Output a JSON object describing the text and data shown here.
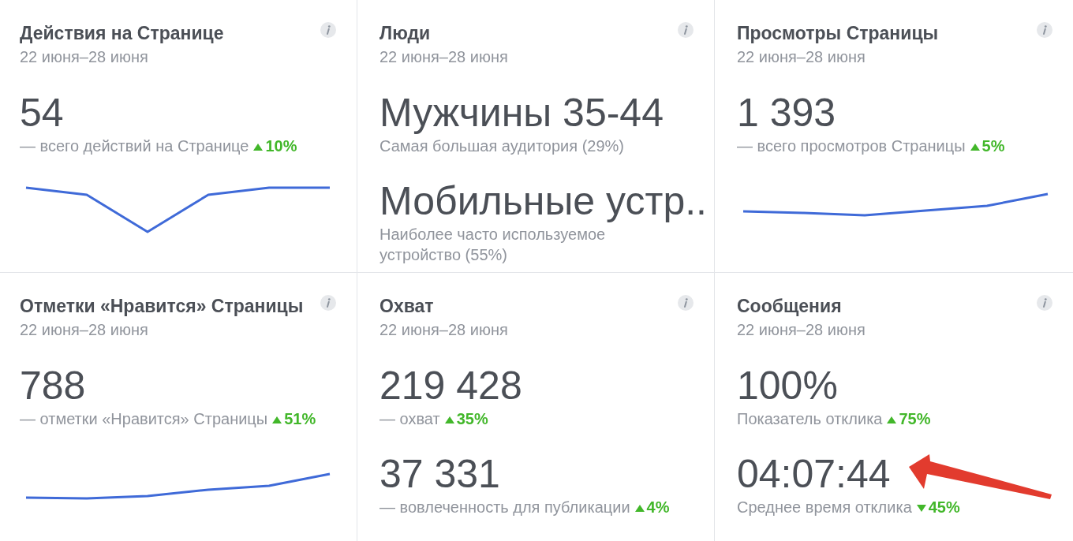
{
  "cards": [
    {
      "kind": "trend",
      "title": "Действия на Странице",
      "date": "22 июня–28 июня",
      "metrics": [
        {
          "value": "54",
          "caption": "— всего действий на Странице",
          "change": "10%",
          "rising": true,
          "highlighted": false
        }
      ]
    },
    {
      "kind": "summary",
      "title": "Люди",
      "date": "22 июня–28 июня",
      "metrics": [
        {
          "value": "Мужчины 35-44",
          "caption": "Самая большая аудитория (29%)",
          "highlighted": false
        },
        {
          "value": "Мобильные устр..",
          "caption": "Наиболее часто используемое устройство (55%)",
          "highlighted": false
        }
      ]
    },
    {
      "kind": "trend",
      "title": "Просмотры Страницы",
      "date": "22 июня–28 июня",
      "metrics": [
        {
          "value": "1 393",
          "caption": "— всего просмотров Страницы",
          "change": "5%",
          "rising": true,
          "highlighted": false
        }
      ]
    },
    {
      "kind": "trend",
      "title": "Отметки «Нравится» Страницы",
      "date": "22 июня–28 июня",
      "metrics": [
        {
          "value": "788",
          "caption": "— отметки «Нравится» Страницы",
          "change": "51%",
          "rising": true,
          "highlighted": false
        }
      ]
    },
    {
      "kind": "summary",
      "title": "Охват",
      "date": "22 июня–28 июня",
      "metrics": [
        {
          "value": "219 428",
          "caption": "— охват",
          "change": "35%",
          "rising": true,
          "highlighted": false
        },
        {
          "value": "37 331",
          "caption": "— вовлеченность для публикации",
          "change": "4%",
          "rising": true,
          "highlighted": false
        }
      ]
    },
    {
      "kind": "summary",
      "title": "Сообщения",
      "date": "22 июня–28 июня",
      "metrics": [
        {
          "value": "100%",
          "caption": "Показатель отклика",
          "change": "75%",
          "rising": true,
          "highlighted": false
        },
        {
          "value": "04:07:44",
          "caption": "Среднее время отклика",
          "change": "45%",
          "rising": false,
          "highlighted": true
        }
      ]
    }
  ]
}
